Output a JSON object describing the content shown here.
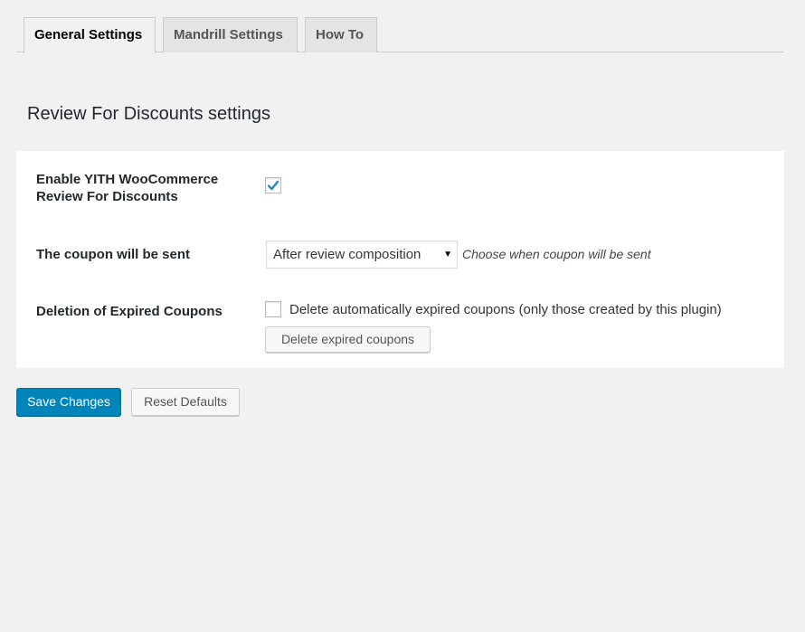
{
  "tabs": [
    {
      "label": "General Settings",
      "active": true
    },
    {
      "label": "Mandrill Settings",
      "active": false
    },
    {
      "label": "How To",
      "active": false
    }
  ],
  "section": {
    "title": "Review For Discounts settings"
  },
  "settings": {
    "enable": {
      "label": "Enable YITH WooCommerce Review For Discounts",
      "checked": true,
      "check_icon": "checkmark-icon"
    },
    "coupon_sent": {
      "label": "The coupon will be sent",
      "selected": "After review composition",
      "description": "Choose when coupon will be sent"
    },
    "deletion": {
      "label": "Deletion of Expired Coupons",
      "checkbox_label": "Delete automatically expired coupons (only those created by this plugin)",
      "checked": false,
      "button_label": "Delete expired coupons"
    }
  },
  "actions": {
    "save_label": "Save Changes",
    "reset_label": "Reset Defaults"
  },
  "colors": {
    "primary": "#0085ba",
    "background": "#f1f1f1",
    "check": "#1e8cbe"
  }
}
